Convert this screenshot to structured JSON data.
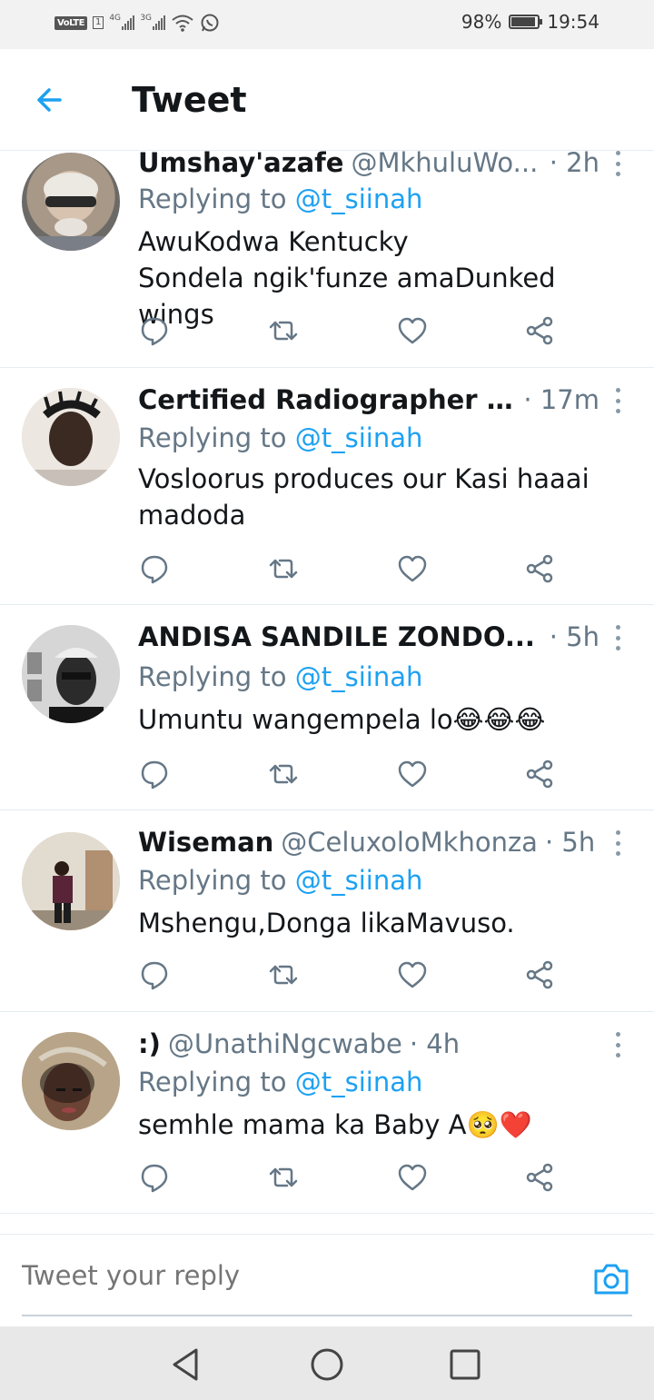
{
  "status_bar": {
    "volte": "VoLTE",
    "sim": "1",
    "net1": "4G",
    "net2": "3G",
    "battery": "98%",
    "time": "19:54"
  },
  "header": {
    "title": "Tweet"
  },
  "tweets": [
    {
      "name": "Umshay'azafe",
      "handle": "@MkhuluWo...",
      "time": "· 2h",
      "replying_label": "Replying to",
      "replying_handle": "@t_siinah",
      "text_lines": [
        "AwuKodwa Kentucky",
        "Sondela ngik'funze amaDunked wings"
      ]
    },
    {
      "name": "Certified Radiographer ...",
      "handle": "",
      "time": "· 17m",
      "replying_label": "Replying to",
      "replying_handle": "@t_siinah",
      "text_lines": [
        "Vosloorus produces our Kasi haaai",
        "madoda"
      ]
    },
    {
      "name": "ANDISA SANDILE ZONDO...",
      "handle": "",
      "time": "· 5h",
      "replying_label": "Replying to",
      "replying_handle": "@t_siinah",
      "text_lines": [
        "Umuntu wangempela lo😂😂😂"
      ]
    },
    {
      "name": "Wiseman",
      "handle": "@CeluxoloMkhonza",
      "time": "· 5h",
      "replying_label": "Replying to",
      "replying_handle": "@t_siinah",
      "text_lines": [
        "Mshengu,Donga likaMavuso."
      ]
    },
    {
      "name": ":)",
      "handle": "@UnathiNgcwabe",
      "time": "· 4h",
      "replying_label": "Replying to",
      "replying_handle": "@t_siinah",
      "text_lines": [
        "semhle mama ka Baby A🥺❤️"
      ]
    }
  ],
  "icons": {
    "reply": "reply-icon",
    "retweet": "retweet-icon",
    "like": "heart-icon",
    "share": "share-icon"
  },
  "reply_bar": {
    "placeholder": "Tweet your reply"
  },
  "colors": {
    "accent": "#1da1f2",
    "muted": "#657786",
    "text": "#14171a"
  }
}
